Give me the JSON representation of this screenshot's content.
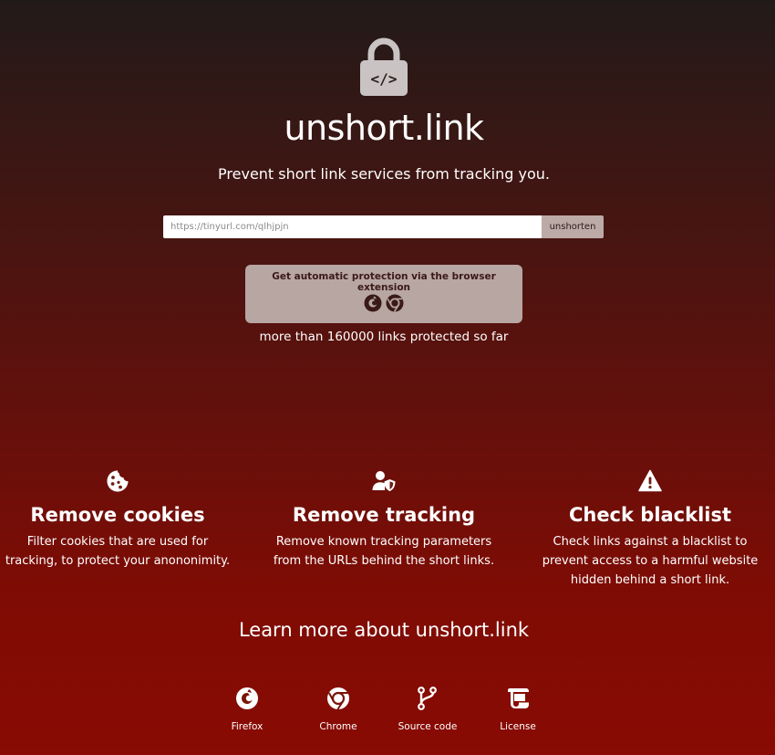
{
  "header": {
    "title": "unshort.link",
    "tagline": "Prevent short link services from tracking you."
  },
  "form": {
    "placeholder": "https://tinyurl.com/qlhjpjn",
    "button_label": "unshorten"
  },
  "extension": {
    "text": "Get automatic protection via the browser extension",
    "icons": [
      "firefox-icon",
      "chrome-icon"
    ]
  },
  "counter": "more than 160000 links protected so far",
  "features": [
    {
      "icon": "cookie-icon",
      "title": "Remove cookies",
      "description": "Filter cookies that are used for tracking, to protect your anononimity."
    },
    {
      "icon": "user-shield-icon",
      "title": "Remove tracking",
      "description": "Remove known tracking parameters from the URLs behind the short links."
    },
    {
      "icon": "warning-icon",
      "title": "Check blacklist",
      "description": "Check links against a blacklist to prevent access to a harmful website hidden behind a short link."
    }
  ],
  "learn_more": "Learn more about unshort.link",
  "footer": {
    "links": [
      {
        "label": "Firefox",
        "icon": "firefox-icon"
      },
      {
        "label": "Chrome",
        "icon": "chrome-icon"
      },
      {
        "label": "Source code",
        "icon": "code-branch-icon"
      },
      {
        "label": "License",
        "icon": "scroll-icon"
      }
    ]
  },
  "colors": {
    "background_top": "#221a19",
    "background_bottom": "#890b03",
    "button": "#bcaaa7",
    "extension_box": "#b8a6a3",
    "extension_text": "#3a1a17"
  }
}
